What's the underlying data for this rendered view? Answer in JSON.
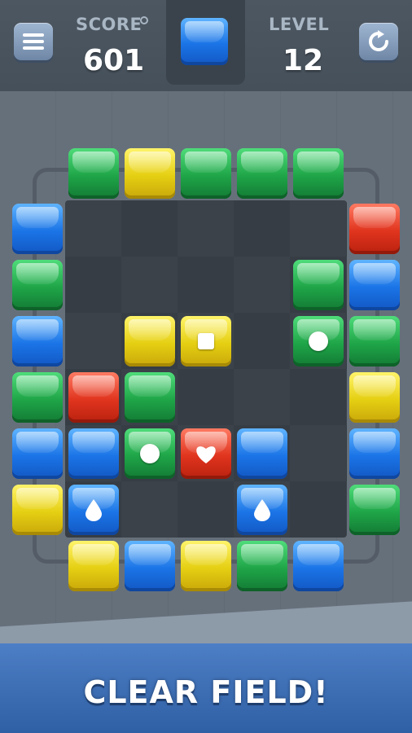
{
  "hud": {
    "score_label": "SCORE",
    "score_value": "601",
    "level_label": "LEVEL",
    "level_value": "12",
    "next_block_color": "blue"
  },
  "colors": {
    "blue": "#1b74e6",
    "green": "#1fa548",
    "yellow": "#e5cf12",
    "red": "#e0341e",
    "banner": "#3b6db5"
  },
  "board": {
    "top_row": [
      "green",
      "yellow",
      "green",
      "green",
      "green"
    ],
    "left_column": [
      "blue",
      "green",
      "blue",
      "green",
      "blue",
      "yellow"
    ],
    "right_column": [
      "red",
      "blue",
      "green",
      "yellow",
      "blue",
      "green"
    ],
    "bottom_row": [
      "yellow",
      "blue",
      "yellow",
      "green",
      "blue"
    ],
    "inner_blocks": [
      {
        "color": "yellow",
        "symbol": ""
      },
      {
        "color": "green",
        "symbol": "",
        "position": "row-2-col-5"
      },
      {
        "color": "yellow",
        "symbol": "square-icon"
      },
      {
        "color": "green",
        "symbol": "circle-icon"
      },
      {
        "color": "red",
        "symbol": ""
      },
      {
        "color": "green",
        "symbol": ""
      },
      {
        "color": "blue",
        "symbol": ""
      },
      {
        "color": "green",
        "symbol": "circle-icon"
      },
      {
        "color": "red",
        "symbol": "heart-icon"
      },
      {
        "color": "blue",
        "symbol": ""
      },
      {
        "color": "blue",
        "symbol": "drop-icon"
      },
      {
        "color": "blue",
        "symbol": "drop-icon"
      }
    ]
  },
  "banner": {
    "text": "CLEAR FIELD!"
  }
}
